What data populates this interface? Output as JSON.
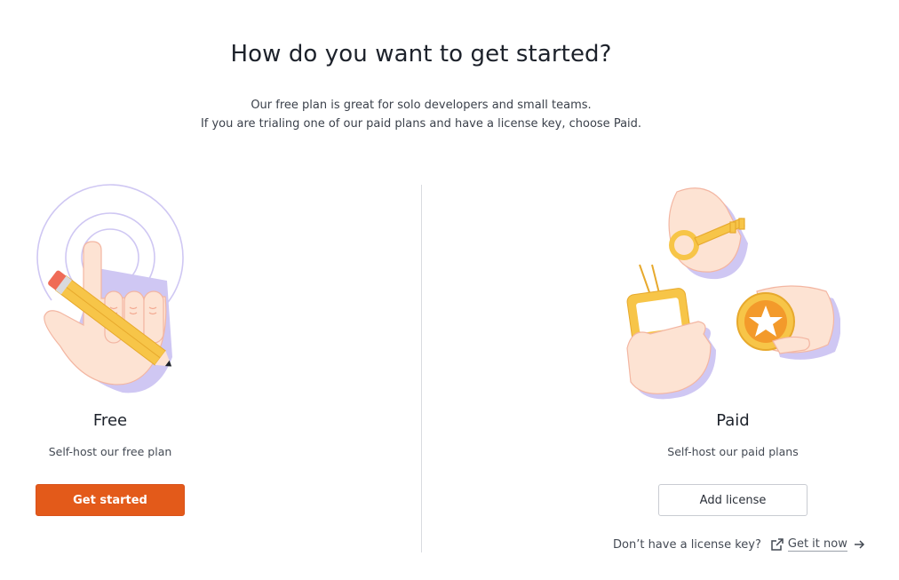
{
  "header": {
    "title": "How do you want to get started?",
    "subtitle_line1": "Our free plan is great for solo developers and small teams.",
    "subtitle_line2": "If you are trialing one of our paid plans and have a license key, choose Paid."
  },
  "free": {
    "name": "Free",
    "description": "Self-host our free plan",
    "button_label": "Get started"
  },
  "paid": {
    "name": "Paid",
    "description": "Self-host our paid plans",
    "button_label": "Add license",
    "license_question": "Don’t have a license key?",
    "license_link": "Get it now"
  },
  "colors": {
    "accent": "#e35a1a",
    "divider": "#d9dbe0",
    "illustration_yellow": "#f7c548",
    "illustration_skin": "#fde3d3",
    "illustration_lavender": "#cfc7f3"
  },
  "icons": [
    "pencil-hand-illustration",
    "key-badge-coin-hands-illustration",
    "external-link-icon",
    "arrow-right-icon"
  ]
}
